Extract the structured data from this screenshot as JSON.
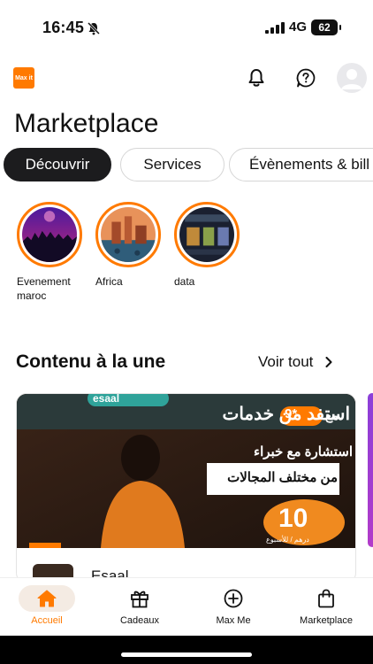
{
  "status": {
    "time": "16:45",
    "network": "4G",
    "battery": "62"
  },
  "header": {
    "logo_text": "Max it",
    "title": "Marketplace"
  },
  "chips": [
    {
      "label": "Découvrir",
      "active": true
    },
    {
      "label": "Services",
      "active": false
    },
    {
      "label": "Évènements & bill",
      "active": false
    }
  ],
  "stories": [
    {
      "label": "Evenement maroc"
    },
    {
      "label": "Africa"
    },
    {
      "label": "data"
    }
  ],
  "featured": {
    "title": "Contenu à la une",
    "see_all": "Voir tout",
    "card": {
      "brand": "esaal",
      "headline_ar": "استفد من خدمات",
      "price_prefix_ar": "مع",
      "price_badge": "9*",
      "consult_ar": "استشارة مع خبراء",
      "fields_ar": "من مختلف المجالات",
      "big_number": "10",
      "unit_ar": "درهم / للأسبوع",
      "name": "Esaal"
    }
  },
  "nav": [
    {
      "label": "Accueil",
      "icon": "home-icon",
      "active": true
    },
    {
      "label": "Cadeaux",
      "icon": "gift-icon",
      "active": false
    },
    {
      "label": "Max Me",
      "icon": "plus-circle-icon",
      "active": false
    },
    {
      "label": "Marketplace",
      "icon": "shopping-bag-icon",
      "active": false
    }
  ],
  "colors": {
    "accent": "#ff7a00",
    "chip_active": "#1c1c1e",
    "text": "#111111"
  }
}
